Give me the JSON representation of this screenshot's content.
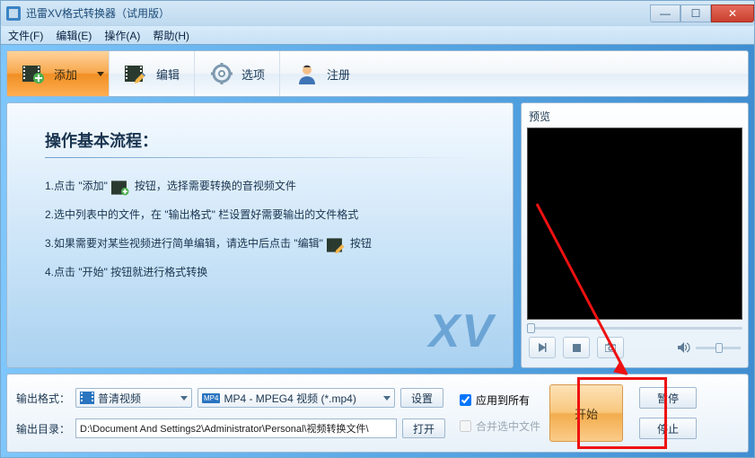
{
  "title": "迅雷XV格式转换器（试用版）",
  "menu": {
    "file": "文件(F)",
    "edit": "编辑(E)",
    "operate": "操作(A)",
    "help": "帮助(H)"
  },
  "toolbar": {
    "add": "添加",
    "edit": "编辑",
    "options": "选项",
    "register": "注册"
  },
  "instructions": {
    "heading": "操作基本流程：",
    "step1a": "1.点击 \"添加\"",
    "step1b": "按钮，选择需要转换的音视频文件",
    "step2": "2.选中列表中的文件，在 \"输出格式\" 栏设置好需要输出的文件格式",
    "step3a": "3.如果需要对某些视频进行简单编辑，请选中后点击 \"编辑\"",
    "step3b": "按钮",
    "step4": "4.点击 \"开始\" 按钮就进行格式转换",
    "logo": "XV"
  },
  "preview": {
    "label": "预览"
  },
  "output": {
    "format_label": "输出格式：",
    "category": "普清视频",
    "format": "MP4 - MPEG4 视频 (*.mp4)",
    "settings": "设置",
    "dir_label": "输出目录：",
    "dir_value": "D:\\Document And Settings2\\Administrator\\Personal\\视频转换文件\\",
    "open": "打开"
  },
  "apply": {
    "apply_all": "应用到所有",
    "merge": "合并选中文件"
  },
  "action": {
    "start": "开始",
    "pause": "暂停",
    "stop": "停止"
  }
}
